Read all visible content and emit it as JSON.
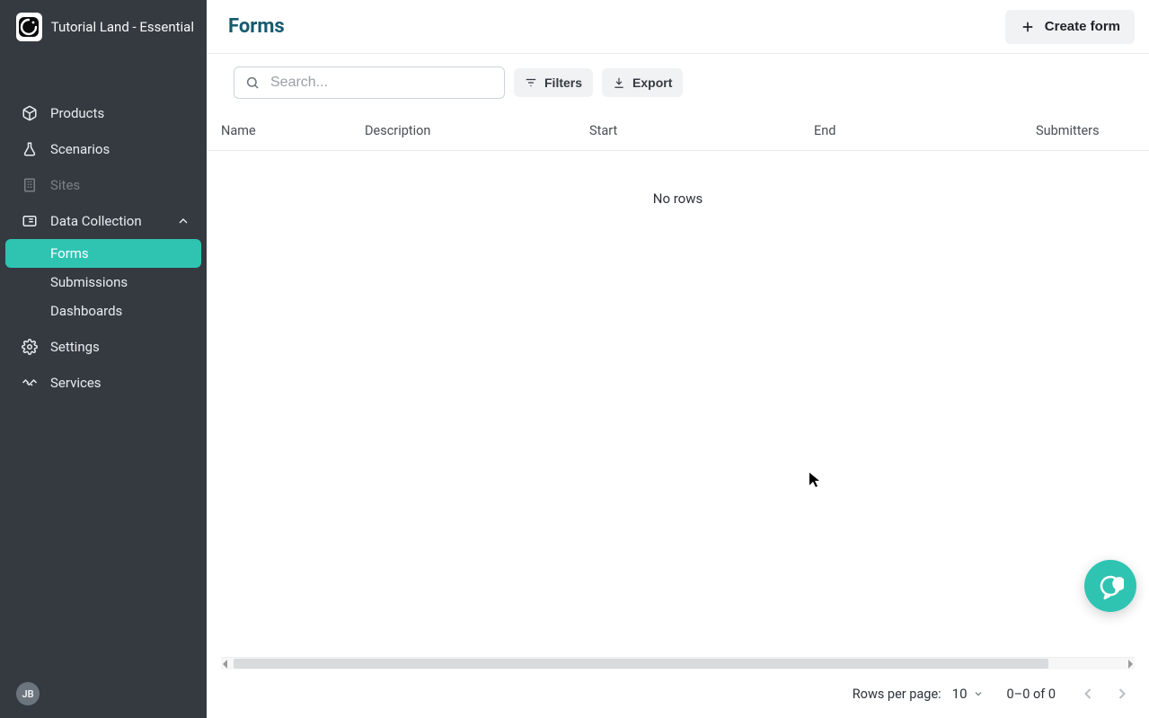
{
  "brand": {
    "title": "Tutorial Land - Essential"
  },
  "sidebar": {
    "items": [
      {
        "label": "Products"
      },
      {
        "label": "Scenarios"
      },
      {
        "label": "Sites"
      },
      {
        "label": "Data Collection"
      },
      {
        "label": "Settings"
      },
      {
        "label": "Services"
      }
    ],
    "data_collection_children": [
      {
        "label": "Forms"
      },
      {
        "label": "Submissions"
      },
      {
        "label": "Dashboards"
      }
    ]
  },
  "user": {
    "initials": "JB"
  },
  "page": {
    "title": "Forms"
  },
  "actions": {
    "create_form": "Create form",
    "filters": "Filters",
    "export": "Export"
  },
  "search": {
    "placeholder": "Search..."
  },
  "table": {
    "columns": {
      "name": "Name",
      "description": "Description",
      "start": "Start",
      "end": "End",
      "submitters": "Submitters"
    },
    "empty_text": "No rows"
  },
  "pagination": {
    "rows_per_page_label": "Rows per page:",
    "rows_per_page_value": "10",
    "range_text": "0–0 of 0"
  },
  "colors": {
    "accent": "#2fc4b2",
    "sidebar_bg": "#343a40",
    "title": "#165a6f"
  }
}
